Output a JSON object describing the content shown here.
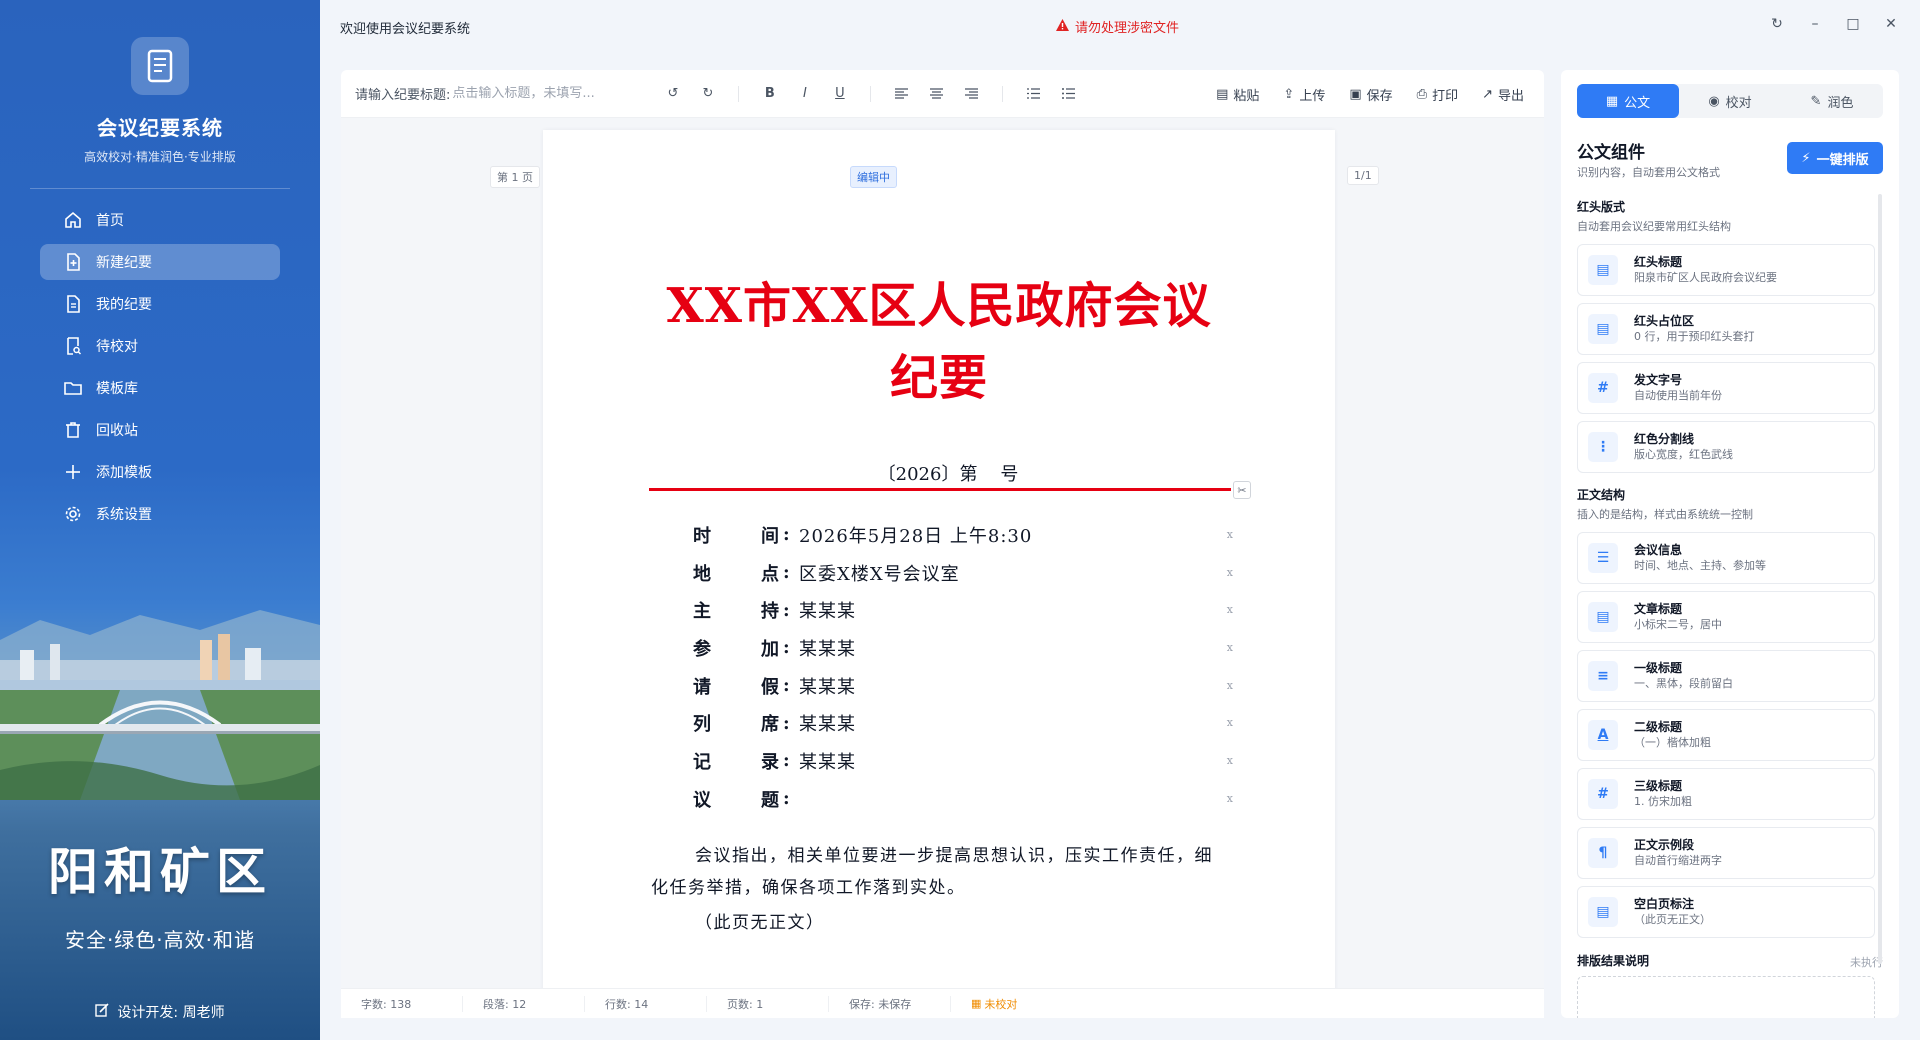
{
  "sidebar": {
    "app_title": "会议纪要系统",
    "app_subtitle": "高效校对·精准润色·专业排版",
    "nav": [
      {
        "label": "首页",
        "icon": "home-icon"
      },
      {
        "label": "新建纪要",
        "icon": "new-doc-icon",
        "active": true
      },
      {
        "label": "我的纪要",
        "icon": "doc-list-icon"
      },
      {
        "label": "待校对",
        "icon": "proofread-icon"
      },
      {
        "label": "模板库",
        "icon": "folder-icon"
      },
      {
        "label": "回收站",
        "icon": "trash-icon"
      },
      {
        "label": "添加模板",
        "icon": "plus-icon"
      },
      {
        "label": "系统设置",
        "icon": "gear-icon"
      }
    ],
    "slogan_big": "阳和矿区",
    "slogan_small": "安全·绿色·高效·和谐",
    "designer": "设计开发: 周老师"
  },
  "topbar": {
    "welcome": "欢迎使用会议纪要系统",
    "warning": "请勿处理涉密文件"
  },
  "toolbar": {
    "title_label": "请输入纪要标题:",
    "title_placeholder": "点击输入标题，未填写...",
    "actions": [
      "粘贴",
      "上传",
      "保存",
      "打印",
      "导出"
    ]
  },
  "editor": {
    "page_tag": "第 1 页",
    "page_count": "1/1",
    "status_badge": "编辑中",
    "red_title": "XX市XX区人民政府会议纪要",
    "doc_number": "〔2026〕第    号",
    "info": [
      {
        "label": [
          "时",
          "间"
        ],
        "value": "2026年5月28日 上午8:30"
      },
      {
        "label": [
          "地",
          "点"
        ],
        "value": "区委X楼X号会议室"
      },
      {
        "label": [
          "主",
          "持"
        ],
        "value": "某某某"
      },
      {
        "label": [
          "参",
          "加"
        ],
        "value": "某某某"
      },
      {
        "label": [
          "请",
          "假"
        ],
        "value": "某某某"
      },
      {
        "label": [
          "列",
          "席"
        ],
        "value": "某某某"
      },
      {
        "label": [
          "记",
          "录"
        ],
        "value": "某某某"
      },
      {
        "label": [
          "议",
          "题"
        ],
        "value": ""
      }
    ],
    "body": "会议指出，相关单位要进一步提高思想认识，压实工作责任，细化任务举措，确保各项工作落到实处。",
    "blank_note": "（此页无正文）"
  },
  "statusbar": {
    "chars": "字数: 138",
    "paragraphs": "段落: 12",
    "lines": "行数: 14",
    "pages": "页数: 1",
    "save": "保存: 未保存",
    "proof": "未校对"
  },
  "rpanel": {
    "tabs": [
      "公文",
      "校对",
      "润色"
    ],
    "title": "公文组件",
    "subtitle": "识别内容，自动套用公文格式",
    "one_click": "一键排版",
    "section1_title": "红头版式",
    "section1_sub": "自动套用会议纪要常用红头结构",
    "section1_cards": [
      {
        "name": "红头标题",
        "desc": "阳泉市矿区人民政府会议纪要",
        "icon": "doc-icon"
      },
      {
        "name": "红头占位区",
        "desc": "0 行，用于预印红头套打",
        "icon": "doc-icon"
      },
      {
        "name": "发文字号",
        "desc": "自动使用当前年份",
        "icon": "hash-icon"
      },
      {
        "name": "红色分割线",
        "desc": "版心宽度，红色武线",
        "icon": "divider-icon"
      }
    ],
    "section2_title": "正文结构",
    "section2_sub": "插入的是结构，样式由系统统一控制",
    "section2_cards": [
      {
        "name": "会议信息",
        "desc": "时间、地点、主持、参加等",
        "icon": "list-icon"
      },
      {
        "name": "文章标题",
        "desc": "小标宋二号，居中",
        "icon": "doc-icon"
      },
      {
        "name": "一级标题",
        "desc": "一、黑体，段前留白",
        "icon": "bullets-icon"
      },
      {
        "name": "二级标题",
        "desc": "（一）楷体加粗",
        "icon": "font-a-icon"
      },
      {
        "name": "三级标题",
        "desc": "1. 仿宋加粗",
        "icon": "hash-icon"
      },
      {
        "name": "正文示例段",
        "desc": "自动首行缩进两字",
        "icon": "paragraph-icon"
      },
      {
        "name": "空白页标注",
        "desc": "（此页无正文）",
        "icon": "doc-icon"
      }
    ],
    "result_title": "排版结果说明",
    "result_state": "未执行"
  }
}
